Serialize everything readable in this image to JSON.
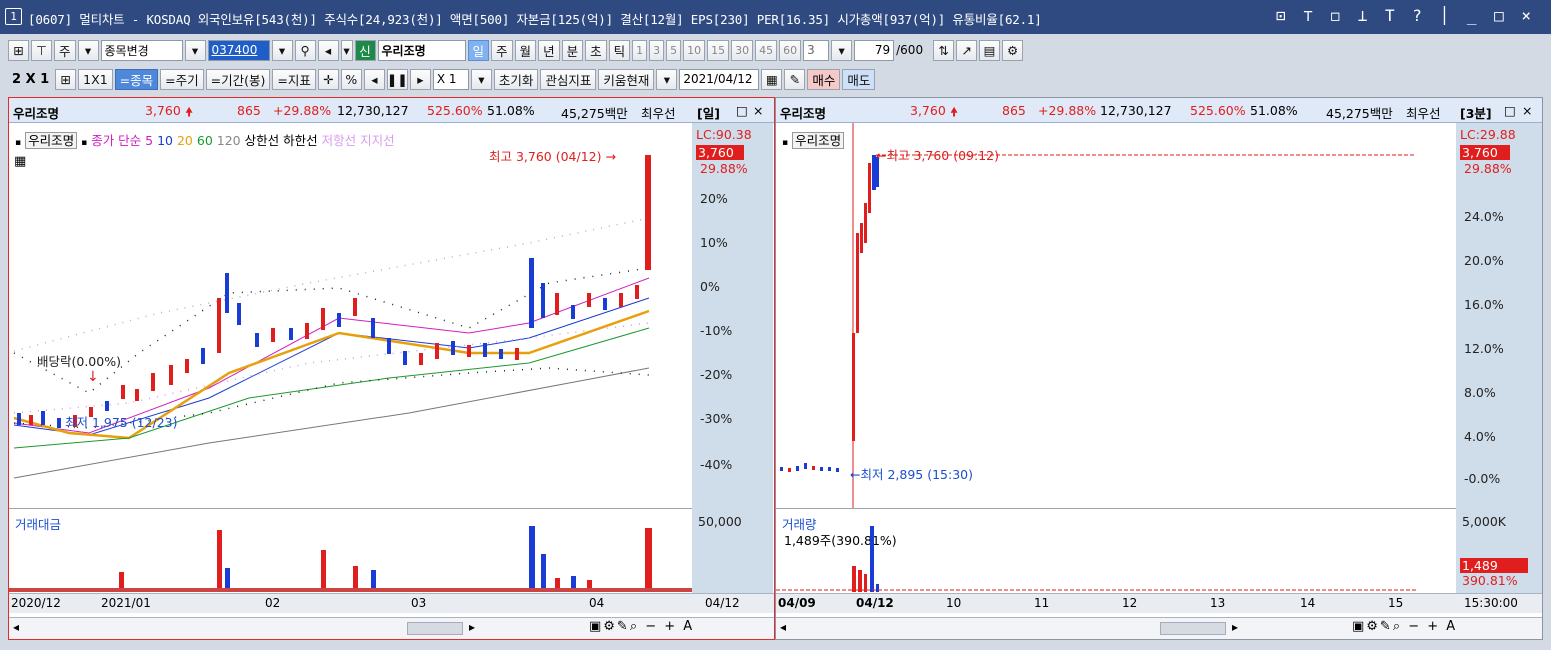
{
  "window": {
    "num": "1",
    "title": "[0607] 멀티차트 - KOSDAQ 외국인보유[543(천)] 주식수[24,923(천)] 액면[500] 자본금[125(억)] 결산[12월] EPS[230] PER[16.35] 시가총액[937(억)] 유통비율[62.1]",
    "controls": "⊡ ⊤ ◻ ⊥ T ? │ _ □ ×"
  },
  "toolbar1": {
    "type": "주",
    "change": "종목변경",
    "code": "037400",
    "sin": "신",
    "stock_name": "우리조명",
    "periods": [
      "일",
      "주",
      "월",
      "년",
      "분",
      "초",
      "틱"
    ],
    "intervals": [
      "1",
      "3",
      "5",
      "10",
      "15",
      "30",
      "45",
      "60"
    ],
    "count_sel": "3",
    "count_val": "79",
    "count_max": "/600"
  },
  "toolbar2": {
    "layout": "2 X 1",
    "one": "1X1",
    "items": [
      "=종목",
      "=주기",
      "=기간(봉)",
      "=지표"
    ],
    "pct": "%",
    "mult": "X 1",
    "reset": "초기화",
    "interest": "관심지표",
    "kiwoom": "키움현재",
    "date": "2021/04/12",
    "buy": "매수",
    "sell": "매도"
  },
  "left": {
    "name": "우리조명",
    "price": "3,760",
    "change": "865",
    "rate": "+29.88%",
    "volume": "12,730,127",
    "vol_rate": "525.60%",
    "ratio": "51.08%",
    "amount": "45,275백만",
    "priority": "최우선",
    "period": "[일]",
    "legend": {
      "name": "우리조명",
      "ma_label": "종가 단순",
      "ma": [
        "5",
        "10",
        "20",
        "60",
        "120"
      ],
      "bands": [
        "상한선",
        "하한선",
        "저항선",
        "지지선"
      ]
    },
    "axis_top": "LC:90.38",
    "price_box": "3,760",
    "pct_box": "29.88%",
    "yticks": [
      "20%",
      "10%",
      "0%",
      "-10%",
      "-20%",
      "-30%",
      "-40%"
    ],
    "high": "최고 3,760 (04/12) →",
    "low": "최저 1,975 (12/23)",
    "div": "배당락(0.00%)",
    "vol_title": "거래대금",
    "vol_axis": "50,000",
    "dates": [
      "2020/12",
      "2021/01",
      "02",
      "03",
      "04"
    ],
    "date_right": "04/12"
  },
  "right": {
    "name": "우리조명",
    "price": "3,760",
    "change": "865",
    "rate": "+29.88%",
    "volume": "12,730,127",
    "vol_rate": "525.60%",
    "ratio": "51.08%",
    "amount": "45,275백만",
    "priority": "최우선",
    "period": "[3분]",
    "legend": {
      "name": "우리조명"
    },
    "axis_top": "LC:29.88",
    "price_box": "3,760",
    "pct_box": "29.88%",
    "yticks": [
      "24.0%",
      "20.0%",
      "16.0%",
      "12.0%",
      "8.0%",
      "4.0%",
      "-0.0%"
    ],
    "high": "←최고 3,760 (09:12)",
    "low": "←최저 2,895 (15:30)",
    "vol_title": "거래량",
    "vol_sub": "1,489주(390.81%)",
    "vol_axis": "5,000K",
    "vol_box": "1,489",
    "vol_pct": "390.81%",
    "dates": [
      "04/09",
      "04/12",
      "10",
      "11",
      "12",
      "13",
      "14",
      "15"
    ],
    "date_right": "15:30:00"
  }
}
